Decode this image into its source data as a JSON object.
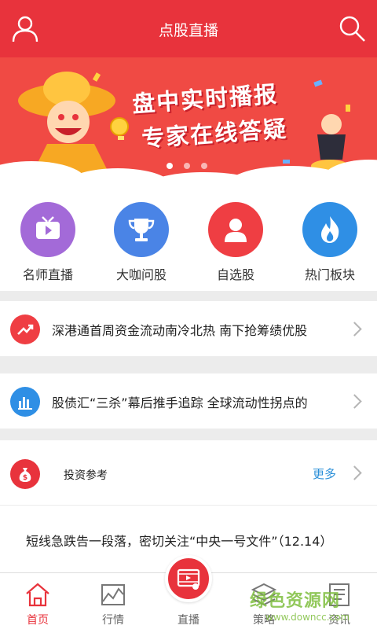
{
  "header": {
    "title": "点股直播",
    "user_icon": "user-icon",
    "search_icon": "search-icon",
    "bg_color": "#e8333c"
  },
  "banner": {
    "line1": "盘中实时播报",
    "line2": "专家在线答疑",
    "page_count": 3,
    "active_page": 1
  },
  "quick_menu": [
    {
      "label": "名师直播",
      "icon": "tv-icon",
      "color": "#a36ad8"
    },
    {
      "label": "大咖问股",
      "icon": "trophy-icon",
      "color": "#4a84e6"
    },
    {
      "label": "自选股",
      "icon": "user-icon",
      "color": "#ef3e43"
    },
    {
      "label": "热门板块",
      "icon": "fire-icon",
      "color": "#2f8fe5"
    }
  ],
  "news": [
    {
      "text": "深港通首周资金流动南冷北热 南下抢筹绩优股",
      "icon": "trend-up-icon",
      "color": "#ef3e43"
    },
    {
      "text": "股债汇“三杀”幕后推手追踪 全球流动性拐点的",
      "icon": "bar-chart-icon",
      "color": "#2f8fe5"
    }
  ],
  "invest_ref": {
    "label": "投资参考",
    "more": "更多",
    "icon": "money-bag-icon"
  },
  "article": {
    "text": "短线急跌告一段落，密切关注“中央一号文件”（12.14）"
  },
  "tabs": [
    {
      "label": "首页",
      "icon": "home-icon",
      "active": true
    },
    {
      "label": "行情",
      "icon": "chart-icon",
      "active": false
    },
    {
      "label": "直播",
      "icon": "video-icon",
      "active": false
    },
    {
      "label": "策略",
      "icon": "layers-icon",
      "active": false
    },
    {
      "label": "资讯",
      "icon": "news-icon",
      "active": false
    }
  ],
  "watermark": {
    "title": "绿色资源网",
    "url": "www.downcc.com"
  }
}
